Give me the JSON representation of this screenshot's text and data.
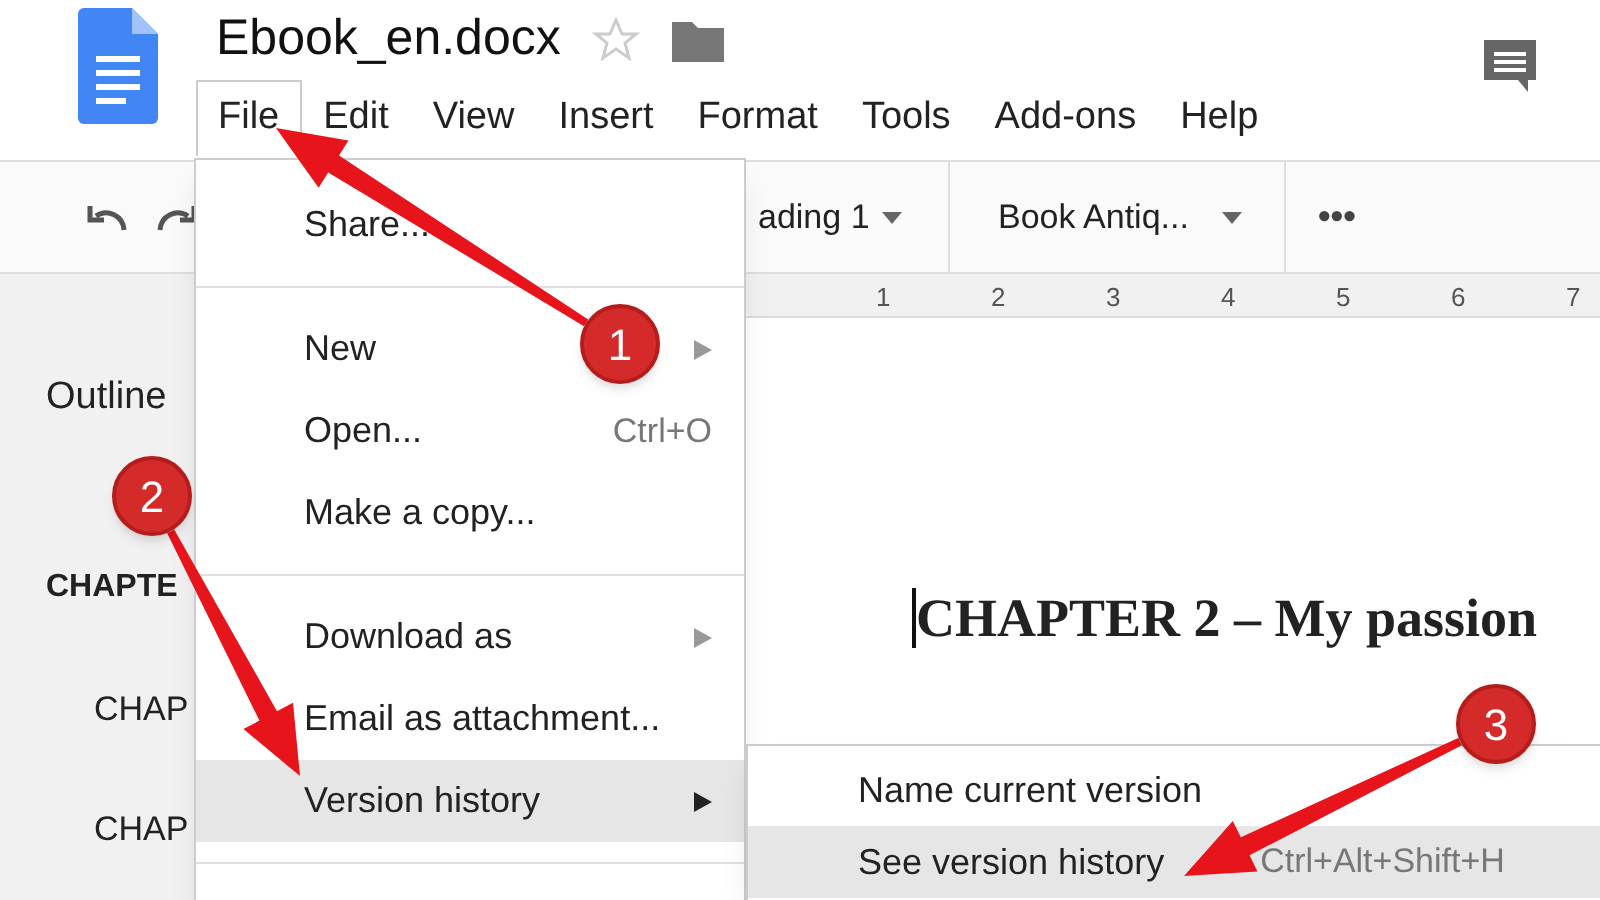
{
  "app": {
    "title": "Ebook_en.docx",
    "menus": [
      {
        "label": "File",
        "selected": true
      },
      {
        "label": "Edit",
        "selected": false
      },
      {
        "label": "View",
        "selected": false
      },
      {
        "label": "Insert",
        "selected": false
      },
      {
        "label": "Format",
        "selected": false
      },
      {
        "label": "Tools",
        "selected": false
      },
      {
        "label": "Add-ons",
        "selected": false
      },
      {
        "label": "Help",
        "selected": false
      }
    ]
  },
  "toolbar": {
    "style": "ading 1",
    "font": "Book Antiq...",
    "more": "•••"
  },
  "ruler": {
    "marks": [
      "1",
      "2",
      "3",
      "4",
      "5",
      "6",
      "7"
    ]
  },
  "outline": {
    "title": "Outline",
    "items": [
      {
        "text": "CHAPTE",
        "children": [
          {
            "text": "CHAP"
          },
          {
            "text": "CHAP"
          }
        ]
      }
    ]
  },
  "document": {
    "heading": "CHAPTER 2 – My passion"
  },
  "file_menu": {
    "items": [
      {
        "kind": "item",
        "label": "Share...",
        "selected": false
      },
      {
        "kind": "divider"
      },
      {
        "kind": "item",
        "label": "New",
        "submenu": true,
        "selected": false
      },
      {
        "kind": "item",
        "label": "Open...",
        "shortcut": "Ctrl+O",
        "selected": false
      },
      {
        "kind": "item",
        "label": "Make a copy...",
        "selected": false
      },
      {
        "kind": "divider"
      },
      {
        "kind": "item",
        "label": "Download as",
        "submenu": true,
        "selected": false
      },
      {
        "kind": "item",
        "label": "Email as attachment...",
        "selected": false
      },
      {
        "kind": "item",
        "label": "Version history",
        "submenu": true,
        "selected": true
      },
      {
        "kind": "divider"
      }
    ]
  },
  "version_submenu": {
    "items": [
      {
        "label": "Name current version",
        "selected": false
      },
      {
        "label": "See version history",
        "shortcut": "Ctrl+Alt+Shift+H",
        "selected": true
      }
    ]
  },
  "callouts": [
    {
      "number": "1"
    },
    {
      "number": "2"
    },
    {
      "number": "3"
    }
  ]
}
